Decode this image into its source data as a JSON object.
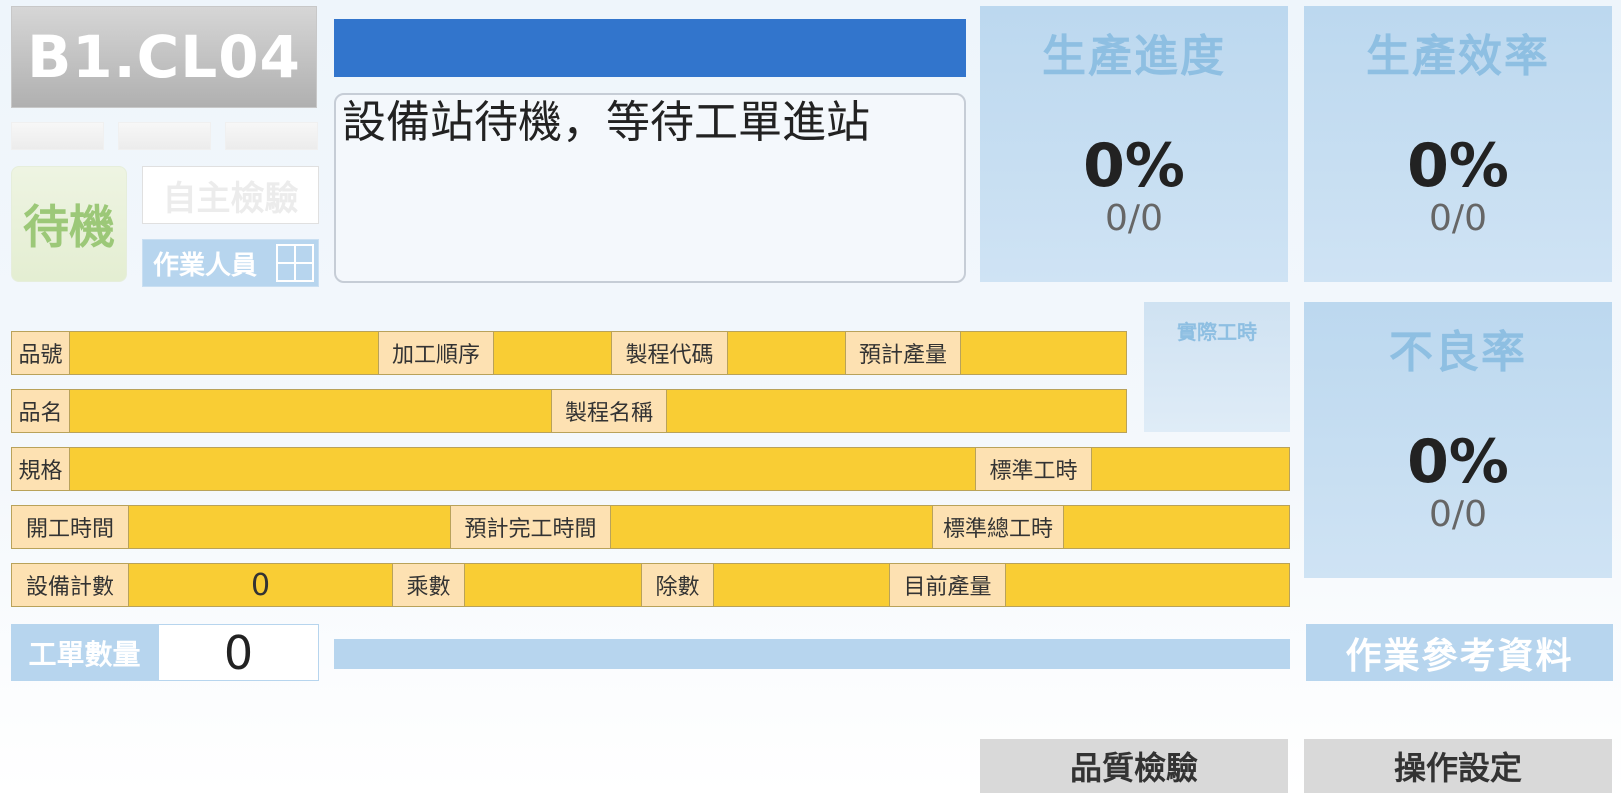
{
  "station": {
    "id": "B1.CL04"
  },
  "status": {
    "state": "待機",
    "self_inspection": "自主檢驗",
    "operator_label": "作業人員"
  },
  "message": "設備站待機，等待工單進站",
  "kpis": {
    "progress": {
      "title": "生產進度",
      "percent": "0%",
      "ratio": "0/0"
    },
    "efficiency": {
      "title": "生產效率",
      "percent": "0%",
      "ratio": "0/0"
    },
    "defect": {
      "title": "不良率",
      "percent": "0%",
      "ratio": "0/0"
    }
  },
  "actual_hours_label": "實際工時",
  "fields": {
    "part_no": {
      "label": "品號",
      "value": ""
    },
    "process_seq": {
      "label": "加工順序",
      "value": ""
    },
    "process_code": {
      "label": "製程代碼",
      "value": ""
    },
    "planned_qty": {
      "label": "預計產量",
      "value": ""
    },
    "part_name": {
      "label": "品名",
      "value": ""
    },
    "process_name": {
      "label": "製程名稱",
      "value": ""
    },
    "spec": {
      "label": "規格",
      "value": ""
    },
    "std_hours": {
      "label": "標準工時",
      "value": ""
    },
    "start_time": {
      "label": "開工時間",
      "value": ""
    },
    "planned_finish": {
      "label": "預計完工時間",
      "value": ""
    },
    "std_total_hours": {
      "label": "標準總工時",
      "value": ""
    },
    "equip_count": {
      "label": "設備計數",
      "value": "0"
    },
    "multiplier": {
      "label": "乘數",
      "value": ""
    },
    "divisor": {
      "label": "除數",
      "value": ""
    },
    "current_output": {
      "label": "目前產量",
      "value": ""
    }
  },
  "work_order": {
    "label": "工單數量",
    "value": "0"
  },
  "buttons": {
    "reference": "作業參考資料",
    "quality": "品質檢驗",
    "settings": "操作設定"
  },
  "colors": {
    "accent_blue": "#3275cc",
    "field_yellow": "#f9cd34",
    "label_cream": "#fde1b2",
    "panel_blue": "#b7d5ee"
  }
}
